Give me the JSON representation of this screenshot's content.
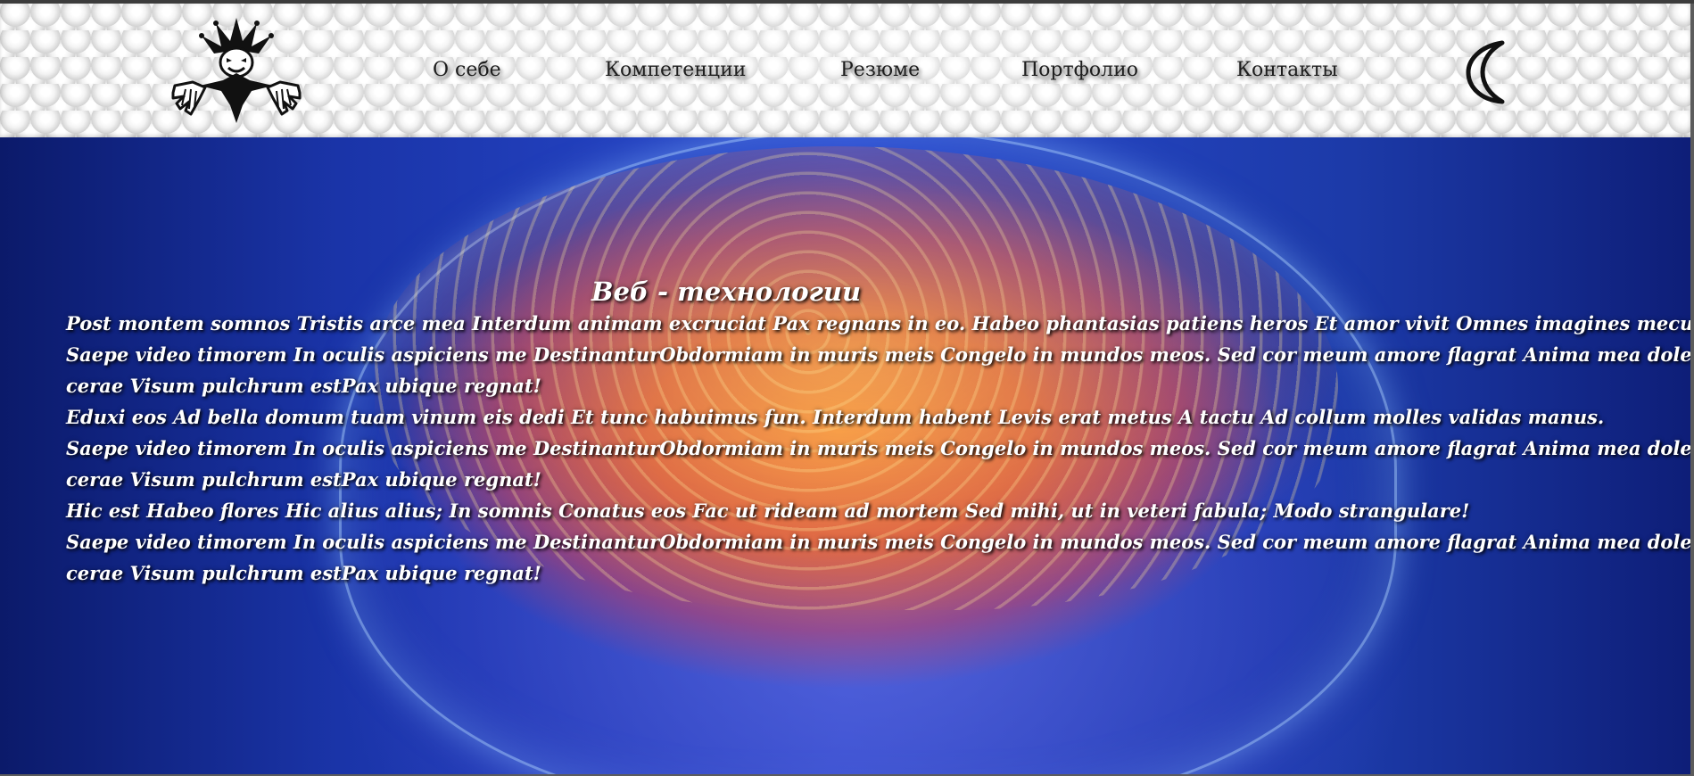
{
  "header": {
    "logo_name": "jester-logo",
    "nav": [
      {
        "label": "О себе"
      },
      {
        "label": "Компетенции"
      },
      {
        "label": "Резюме"
      },
      {
        "label": "Портфолио"
      },
      {
        "label": "Контакты"
      }
    ],
    "theme_toggle_icon": "moon-icon"
  },
  "hero": {
    "title": "Веб - технологии",
    "lines": [
      "Post montem somnos Tristis arce mea Interdum animam excruciat Pax regnans in eo. Habeo phantasias patiens heros Et amor vivit Omnes imagines mecum sunt.",
      "Saepe video timorem In oculis aspiciens me DestinanturObdormiam in muris meis Congelo in mundos meos. Sed cor meum amore flagrat Anima mea dolet Et figuras",
      "cerae Visum pulchrum estPax ubique regnat!",
      "Eduxi eos Ad bella domum tuam vinum eis dedi Et tunc habuimus fun. Interdum habent Levis erat metus A tactu Ad collum molles validas manus.",
      "Saepe video timorem In oculis aspiciens me DestinanturObdormiam in muris meis Congelo in mundos meos. Sed cor meum amore flagrat Anima mea dolet Et figuras",
      "cerae Visum pulchrum estPax ubique regnat!",
      "Hic est Habeo flores Hic alius alius; In somnis Conatus eos Fac ut rideam ad mortem Sed mihi, ut in veteri fabula; Modo strangulare!",
      "Saepe video timorem In oculis aspiciens me DestinanturObdormiam in muris meis Congelo in mundos meos. Sed cor meum amore flagrat Anima mea dolet Et figuras",
      "cerae Visum pulchrum estPax ubique regnat!"
    ]
  },
  "colors": {
    "text": "#ffffff",
    "nav_text": "#1d1d1d",
    "hero_blue": "#1a34a8",
    "hero_orange": "#f08a3c"
  }
}
